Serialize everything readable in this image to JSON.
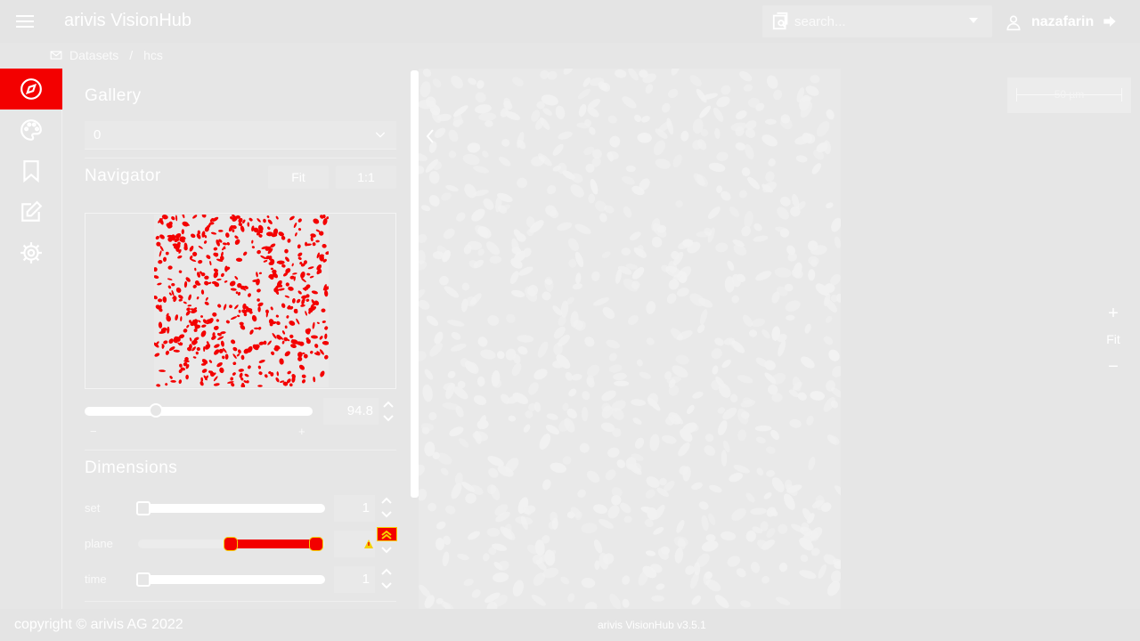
{
  "header": {
    "app_title": "arivis VisionHub",
    "search_placeholder": "search...",
    "user_name": "nazafarin"
  },
  "breadcrumb": {
    "items": [
      "Datasets",
      "hcs"
    ],
    "separator": "/"
  },
  "sidebar": {
    "items": [
      {
        "icon": "compass-icon",
        "active": true
      },
      {
        "icon": "palette-icon",
        "active": false
      },
      {
        "icon": "bookmark-icon",
        "active": false
      },
      {
        "icon": "edit-icon",
        "active": false
      },
      {
        "icon": "gear-icon",
        "active": false
      }
    ]
  },
  "panel": {
    "gallery_title": "Gallery",
    "gallery_value": "0",
    "navigator_title": "Navigator",
    "fit_label": "Fit",
    "one_to_one_label": "1:1",
    "zoom_value": "94.8",
    "zoom_minus": "−",
    "zoom_plus": "+",
    "dimensions_title": "Dimensions",
    "dimensions": [
      {
        "label": "set",
        "value": "1"
      },
      {
        "label": "plane",
        "value": ""
      },
      {
        "label": "time",
        "value": "1"
      }
    ]
  },
  "viewer": {
    "scale_label": "50 µm",
    "zoom_in": "+",
    "fit": "Fit",
    "zoom_out": "−"
  },
  "footer": {
    "copyright": "copyright © arivis AG 2022",
    "version": "arivis VisionHub v3.5.1"
  },
  "colors": {
    "accent": "#f30000",
    "background": "#e6e6e6",
    "warning": "#f6d000"
  }
}
